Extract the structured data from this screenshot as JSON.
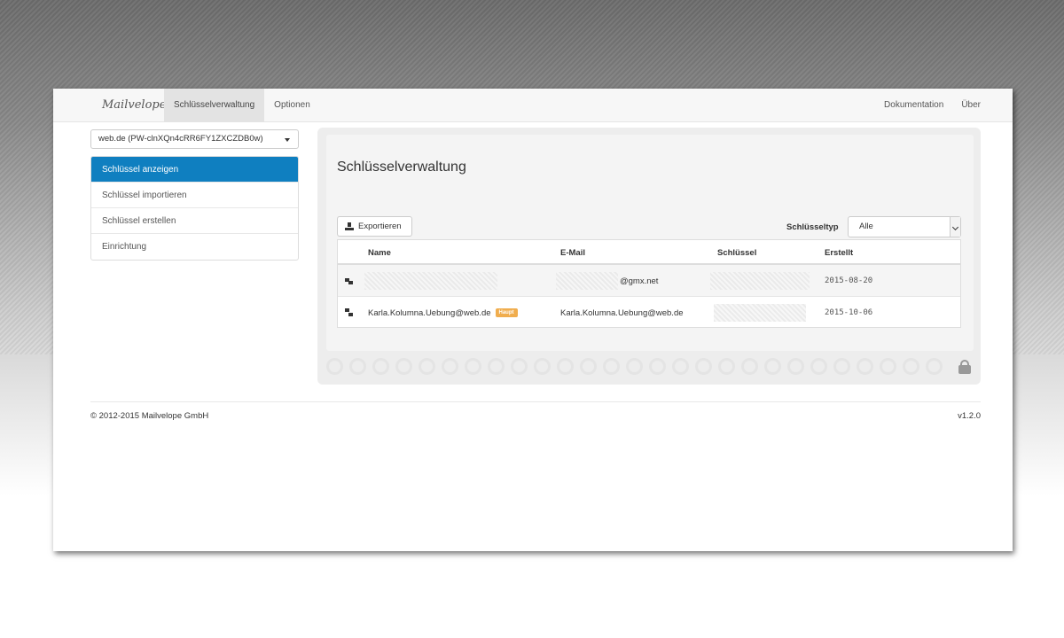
{
  "nav": {
    "brand": "Mailvelope",
    "tabs": [
      {
        "label": "Schlüsselverwaltung",
        "active": true
      },
      {
        "label": "Optionen",
        "active": false
      }
    ],
    "right_links": [
      {
        "label": "Dokumentation"
      },
      {
        "label": "Über"
      }
    ]
  },
  "sidebar": {
    "keyring_select": "web.de (PW-clnXQn4cRR6FY1ZXCZDB0w)",
    "items": [
      {
        "label": "Schlüssel anzeigen",
        "active": true
      },
      {
        "label": "Schlüssel importieren",
        "active": false
      },
      {
        "label": "Schlüssel erstellen",
        "active": false
      },
      {
        "label": "Einrichtung",
        "active": false
      }
    ]
  },
  "main": {
    "title": "Schlüsselverwaltung",
    "export_label": "Exportieren",
    "key_type_label": "Schlüsseltyp",
    "key_type_value": "Alle",
    "table": {
      "headers": [
        "Name",
        "E-Mail",
        "Schlüssel",
        "Erstellt"
      ],
      "rows": [
        {
          "icon": "private-key-icon",
          "name": "",
          "email": "@gmx.net",
          "key": "",
          "created": "2015-08-20",
          "badge": ""
        },
        {
          "icon": "keypair-icon",
          "name": "Karla.Kolumna.Uebung@web.de",
          "email": "Karla.Kolumna.Uebung@web.de",
          "key": "",
          "created": "2015-10-06",
          "badge": "Haupt"
        }
      ]
    }
  },
  "footer": {
    "copyright": "© 2012-2015 Mailvelope GmbH",
    "version": "v1.2.0"
  },
  "colors": {
    "accent": "#0f7fc0",
    "badge": "#f0ad4e"
  }
}
